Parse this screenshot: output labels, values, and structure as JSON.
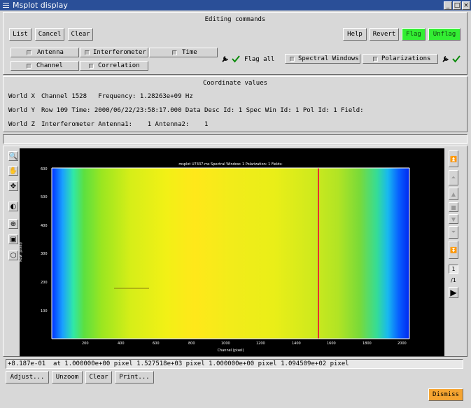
{
  "window": {
    "title": "Msplot display"
  },
  "editing": {
    "heading": "Editing commands",
    "list_label": "List",
    "cancel_label": "Cancel",
    "clear_label": "Clear",
    "help_label": "Help",
    "revert_label": "Revert",
    "flag_label": "Flag",
    "unflag_label": "Unflag",
    "options": {
      "antenna": "Antenna",
      "interferometer": "Interferometer",
      "time": "Time",
      "channel": "Channel",
      "correlation": "Correlation"
    },
    "flag_all_label": "Flag all",
    "spectral_windows_label": "Spectral Windows",
    "polarizations_label": "Polarizations"
  },
  "coords": {
    "heading": "Coordinate values",
    "world_x_label": "World X",
    "world_x_value": "Channel 1528   Frequency: 1.28263e+09 Hz",
    "world_y_label": "World Y",
    "world_y_value": "Row 109 Time: 2000/06/22/23:58:17.000 Data Desc Id: 1 Spec Win Id: 1 Pol Id: 1 Field:",
    "world_z_label": "World Z",
    "world_z_value": "Interferometer Antenna1:    1 Antenna2:    1"
  },
  "plot": {
    "title": "msplot U7437.ms Spectral Window: 1 Polarization: 1 Fields:",
    "xlabel": "Channel (pixel)",
    "ylabel": "Row (pixel)",
    "x_ticks": [
      "200",
      "400",
      "600",
      "800",
      "1000",
      "1200",
      "1400",
      "1600",
      "1800",
      "2000"
    ],
    "y_ticks": [
      "100",
      "200",
      "300",
      "400",
      "500",
      "600"
    ]
  },
  "page": {
    "current": "1",
    "total": "/1"
  },
  "status_text": "+8.187e-01  at 1.000000e+00 pixel 1.527518e+03 pixel 1.000000e+00 pixel 1.094509e+02 pixel",
  "bottom": {
    "adjust_label": "Adjust...",
    "unzoom_label": "Unzoom",
    "clear_label": "Clear",
    "print_label": "Print...",
    "dismiss_label": "Dismiss"
  },
  "colors": {
    "titlebar": "#2a4f98",
    "flag_green": "#33ee33",
    "dismiss_orange": "#f5a431"
  }
}
